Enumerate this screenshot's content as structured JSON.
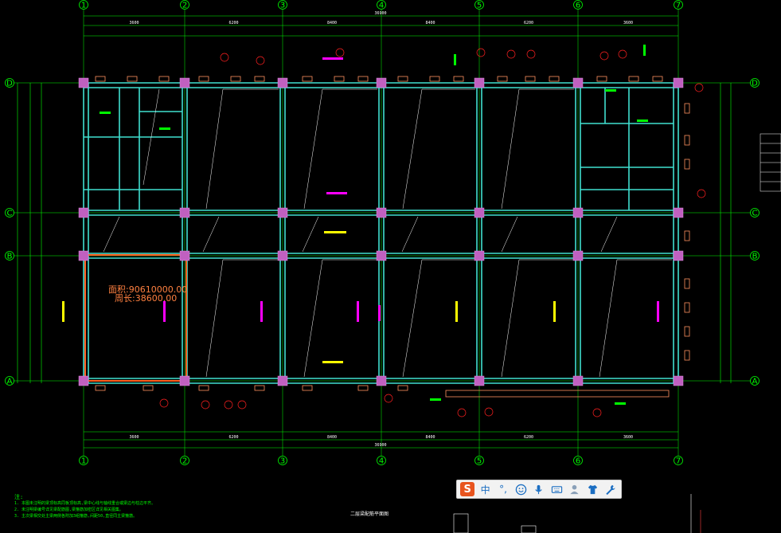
{
  "grid": {
    "vertical_axes": [
      "1",
      "2",
      "3",
      "4",
      "5",
      "6",
      "7"
    ],
    "horizontal_axes": [
      "D",
      "C",
      "B",
      "A"
    ]
  },
  "dimensions": {
    "top_spans": [
      "3600",
      "6200",
      "8400",
      "8400",
      "6200",
      "3600"
    ],
    "total": "36900"
  },
  "area_label": {
    "line1": "面积:90610000.00",
    "line2": "周长:38600.00"
  },
  "notes": {
    "title": "注:",
    "lines": [
      "1. 本图未注明的梁顶标高同板顶标高,梁中心线与轴线重合或梁边与柱边平齐。",
      "2. 未注明梁编号详见梁配筋图,梁箍筋加密区详见相关图集。",
      "3. 主次梁相交处主梁两侧各附加3组箍筋,间距50,直径同主梁箍筋。"
    ]
  },
  "drawing_title": "二层梁配筋平面图",
  "ime": {
    "logo": "S",
    "mode": "中",
    "punct": "°,",
    "colors": {
      "bg": "#f2f2f2",
      "logo": "#e8541e",
      "icon": "#1b6ec2"
    }
  },
  "colors": {
    "background": "#000000",
    "axis": "#00ff00",
    "beam": "#40e0d0",
    "column": "#c060c0",
    "wall": "#ff9060",
    "annotation_magenta": "#ff00ff",
    "annotation_yellow": "#ffff00",
    "selection": "#ff6020"
  }
}
